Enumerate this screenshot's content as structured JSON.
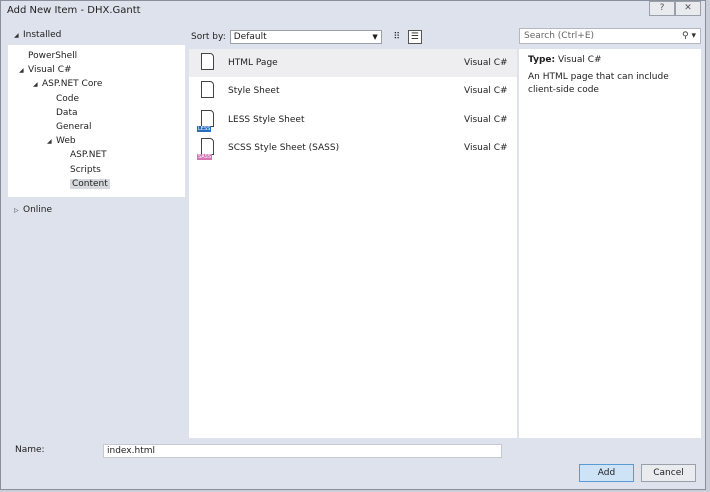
{
  "window": {
    "title": "Add New Item - DHX.Gantt",
    "help_label": "?",
    "close_label": "✕"
  },
  "tree": {
    "installed": "Installed",
    "online": "Online",
    "items": [
      {
        "label": "PowerShell",
        "depth": 1,
        "expander": false
      },
      {
        "label": "Visual C#",
        "depth": 1,
        "expander": true
      },
      {
        "label": "ASP.NET Core",
        "depth": 2,
        "expander": true
      },
      {
        "label": "Code",
        "depth": 3,
        "expander": false
      },
      {
        "label": "Data",
        "depth": 3,
        "expander": false
      },
      {
        "label": "General",
        "depth": 3,
        "expander": false
      },
      {
        "label": "Web",
        "depth": 3,
        "expander": true
      },
      {
        "label": "ASP.NET",
        "depth": 4,
        "expander": false
      },
      {
        "label": "Scripts",
        "depth": 4,
        "expander": false
      },
      {
        "label": "Content",
        "depth": 4,
        "expander": false,
        "selected": true
      }
    ]
  },
  "toolbar": {
    "sort_label": "Sort by:",
    "sort_value": "Default",
    "search_placeholder": "Search (Ctrl+E)"
  },
  "templates": [
    {
      "name": "HTML Page",
      "lang": "Visual C#",
      "icon": "html-file-icon",
      "selected": true
    },
    {
      "name": "Style Sheet",
      "lang": "Visual C#",
      "icon": "css-file-icon"
    },
    {
      "name": "LESS Style Sheet",
      "lang": "Visual C#",
      "icon": "less-file-icon",
      "badge": "LESS",
      "badge_color": "#2a6bbf"
    },
    {
      "name": "SCSS Style Sheet (SASS)",
      "lang": "Visual C#",
      "icon": "scss-file-icon",
      "badge": "SASS",
      "badge_color": "#d873b4"
    }
  ],
  "details": {
    "type_label": "Type:",
    "type_value": "Visual C#",
    "description": "An HTML page that can include client-side code"
  },
  "footer": {
    "name_label": "Name:",
    "name_value": "index.html",
    "add_label": "Add",
    "cancel_label": "Cancel"
  }
}
